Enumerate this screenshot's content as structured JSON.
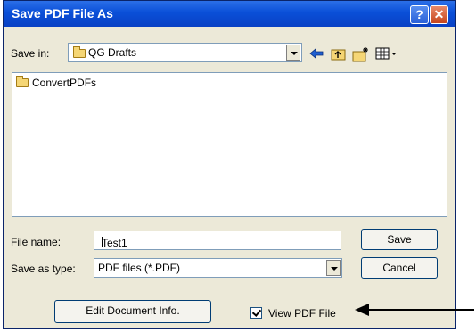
{
  "window": {
    "title": "Save PDF File As",
    "help_label": "?",
    "close_label": "✕"
  },
  "save_in": {
    "label": "Save in:",
    "value": "QG Drafts"
  },
  "toolbar": {
    "icons": [
      "back-icon",
      "up-folder-icon",
      "new-folder-icon",
      "view-menu-icon"
    ]
  },
  "file_list": {
    "items": [
      {
        "name": "ConvertPDFs",
        "icon": "folder-icon"
      }
    ]
  },
  "file_name": {
    "label": "File name:",
    "value": "Test1"
  },
  "save_as_type": {
    "label": "Save as type:",
    "value": "PDF files (*.PDF)"
  },
  "buttons": {
    "save": "Save",
    "cancel": "Cancel",
    "edit_document_info": "Edit Document Info."
  },
  "view_pdf": {
    "label": "View PDF File",
    "checked": true
  }
}
